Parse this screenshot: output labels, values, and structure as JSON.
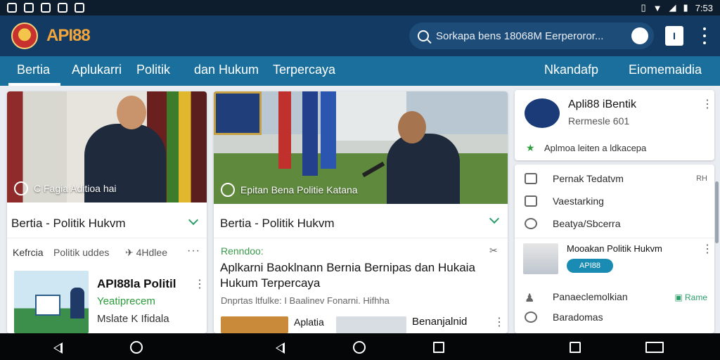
{
  "status": {
    "time": "7:53"
  },
  "header": {
    "brand_logo_text": "API88",
    "brand_tagline": "",
    "search_text": "Sorkapa bens 18068M Eerperoror...",
    "profile_label": "I"
  },
  "nav": {
    "tabs": [
      {
        "label": "Bertia"
      },
      {
        "label": "Aplukarri"
      },
      {
        "label": "Politik"
      },
      {
        "label": "dan Hukum"
      },
      {
        "label": "Terpercaya"
      }
    ],
    "right_links": [
      {
        "label": "Nkandafp"
      },
      {
        "label": "Eiomemaidia"
      }
    ]
  },
  "card1": {
    "caption": "C Fagia Aditioa hai",
    "category": "Bertia - Politik Hukvm",
    "meta_left": "Kefrcia",
    "meta_mid": "Politik uddes",
    "meta_right": "4Hdlee",
    "sub_title": "API88la Politil",
    "sub_green": "Yeatiprecem",
    "sub_line3": "Mslate K Ifidala"
  },
  "card2": {
    "caption": "Epitan Bena Politie Katana",
    "category": "Bertia - Politik Hukvm",
    "tag": "Renndoo:",
    "headline": "Aplkarni Baoklnann Bernia Bernipas dan Hukaia Hukum Terpercaya",
    "byline": "Dnprtas ltfulke: I Baalinev Fonarni. Hifhha",
    "bottom_a": "Aplatia",
    "bottom_b": "Benanjalnid"
  },
  "panel": {
    "top_title": "Apli88 iBentik",
    "top_sub": "Rermesle 601",
    "top_note": "Aplmoa leiten a ldkacepa",
    "rows": [
      {
        "label": "Pernak Tedatvm",
        "aside": "RH"
      },
      {
        "label": "Vaestarking"
      },
      {
        "label": "Beatya/Sbcerra"
      }
    ],
    "feature_title": "Mooakan Politik Hukvm",
    "feature_badge": "API88",
    "row2a": "Panaeclemolkian",
    "row2a_aside": "Rame",
    "row2b": "Baradomas"
  }
}
